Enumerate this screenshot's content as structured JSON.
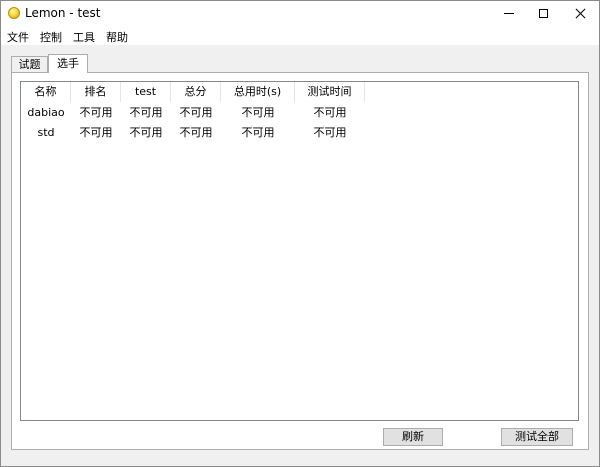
{
  "window": {
    "title": "Lemon - test"
  },
  "menu": {
    "items": [
      {
        "label": "文件"
      },
      {
        "label": "控制"
      },
      {
        "label": "工具"
      },
      {
        "label": "帮助"
      }
    ]
  },
  "tabs": {
    "questions": "试题",
    "players": "选手",
    "active": "选手"
  },
  "table": {
    "columns": [
      "名称",
      "排名",
      "test",
      "总分",
      "总用时(s)",
      "测试时间"
    ],
    "rows": [
      [
        "dabiao",
        "不可用",
        "不可用",
        "不可用",
        "不可用",
        "不可用"
      ],
      [
        "std",
        "不可用",
        "不可用",
        "不可用",
        "不可用",
        "不可用"
      ]
    ]
  },
  "buttons": {
    "refresh": "刷新",
    "judge_all": "测试全部"
  },
  "colors": {
    "chrome_bg": "#f0f0f0",
    "panel_bg": "#ffffff",
    "border": "#adadad",
    "button_bg": "#e1e1e1"
  },
  "icons": {
    "app": "lemon-icon"
  }
}
